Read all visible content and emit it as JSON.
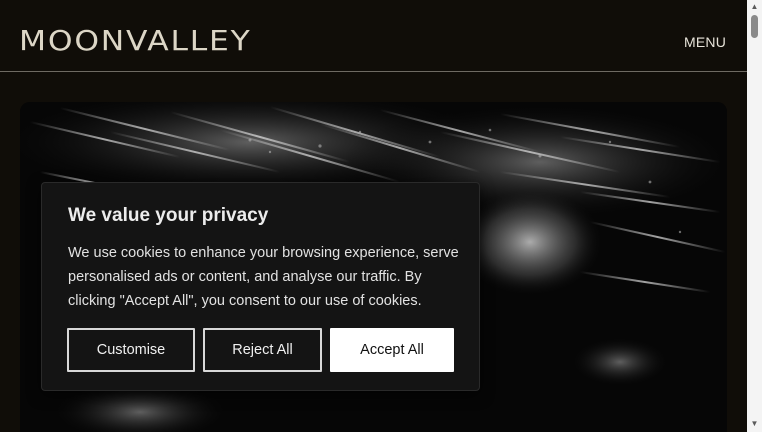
{
  "header": {
    "logo_text": "MOONVALLEY",
    "menu_label": "MENU"
  },
  "hero": {
    "image": "abstract-grayscale-motion-image"
  },
  "cookie_banner": {
    "title": "We value your privacy",
    "body": "We use cookies to enhance your browsing experience, serve personalised ads or content, and analyse our traffic. By clicking \"Accept All\", you consent to our use of cookies.",
    "buttons": {
      "customise": "Customise",
      "reject_all": "Reject All",
      "accept_all": "Accept All"
    }
  },
  "scrollbar": {
    "up_icon": "▲",
    "down_icon": "▼"
  },
  "colors": {
    "page_background": "#100d08",
    "logo_color": "#dcd6c6",
    "banner_background": "#141414",
    "accept_button_bg": "#ffffff"
  }
}
